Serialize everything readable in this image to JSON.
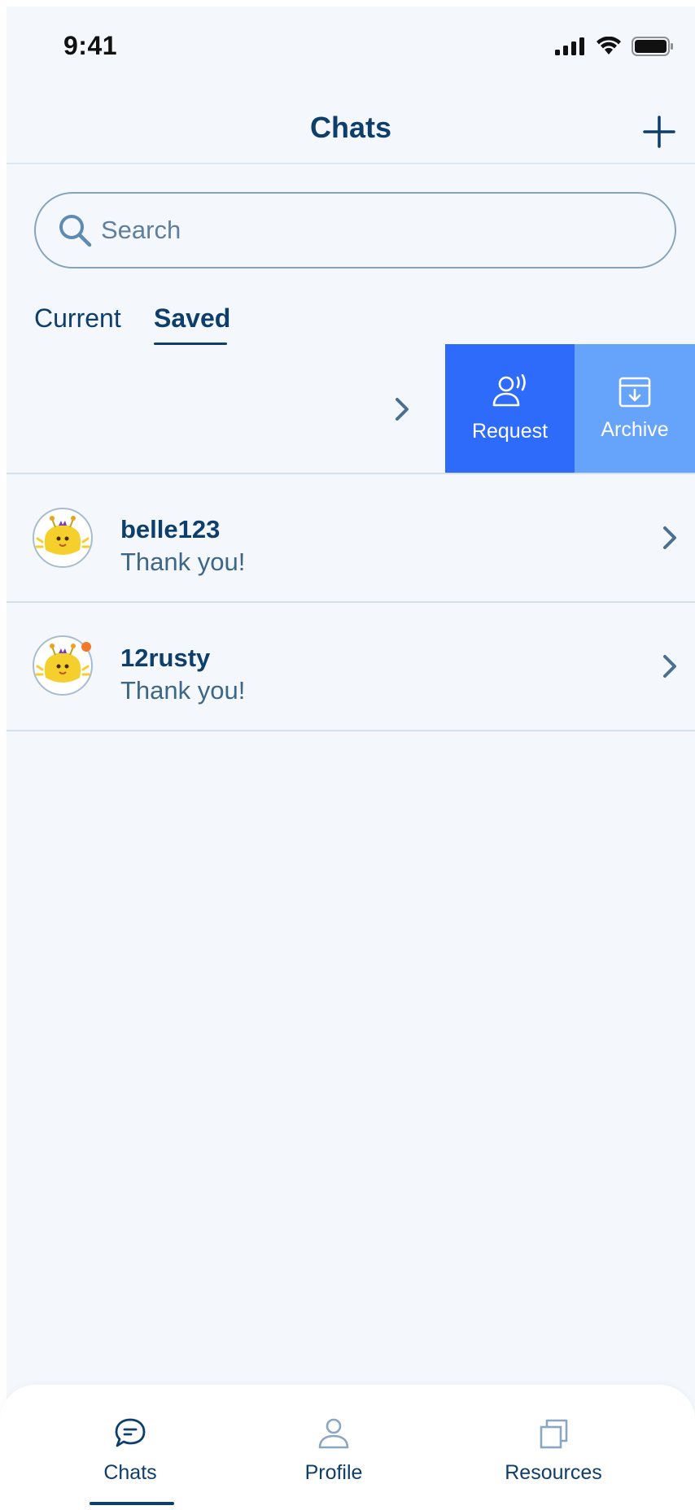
{
  "status_bar": {
    "time": "9:41",
    "icons": [
      "signal-icon",
      "wifi-icon",
      "battery-icon"
    ]
  },
  "header": {
    "title": "Chats",
    "add_icon": "plus-icon"
  },
  "search": {
    "placeholder": "Search",
    "icon": "search-icon"
  },
  "tabs": [
    {
      "label": "Current",
      "active": false
    },
    {
      "label": "Saved",
      "active": true
    }
  ],
  "swipe_actions": [
    {
      "label": "Request",
      "icon": "request-voice-icon",
      "color": "#2f6bfa"
    },
    {
      "label": "Archive",
      "icon": "archive-box-icon",
      "color": "#66a3fb"
    }
  ],
  "chats": [
    {
      "name": "belle123",
      "message": "Thank you!",
      "unread": false
    },
    {
      "name": "12rusty",
      "message": "Thank you!",
      "unread": true
    }
  ],
  "bottom_nav": [
    {
      "label": "Chats",
      "icon": "chat-bubble-icon",
      "active": true
    },
    {
      "label": "Profile",
      "icon": "person-icon",
      "active": false
    },
    {
      "label": "Resources",
      "icon": "copy-pages-icon",
      "active": false
    }
  ],
  "colors": {
    "primary": "#0e3e6b",
    "background": "#f4f8fd",
    "request": "#2f6bfa",
    "archive": "#66a3fb",
    "unread_dot": "#f07a2a"
  }
}
